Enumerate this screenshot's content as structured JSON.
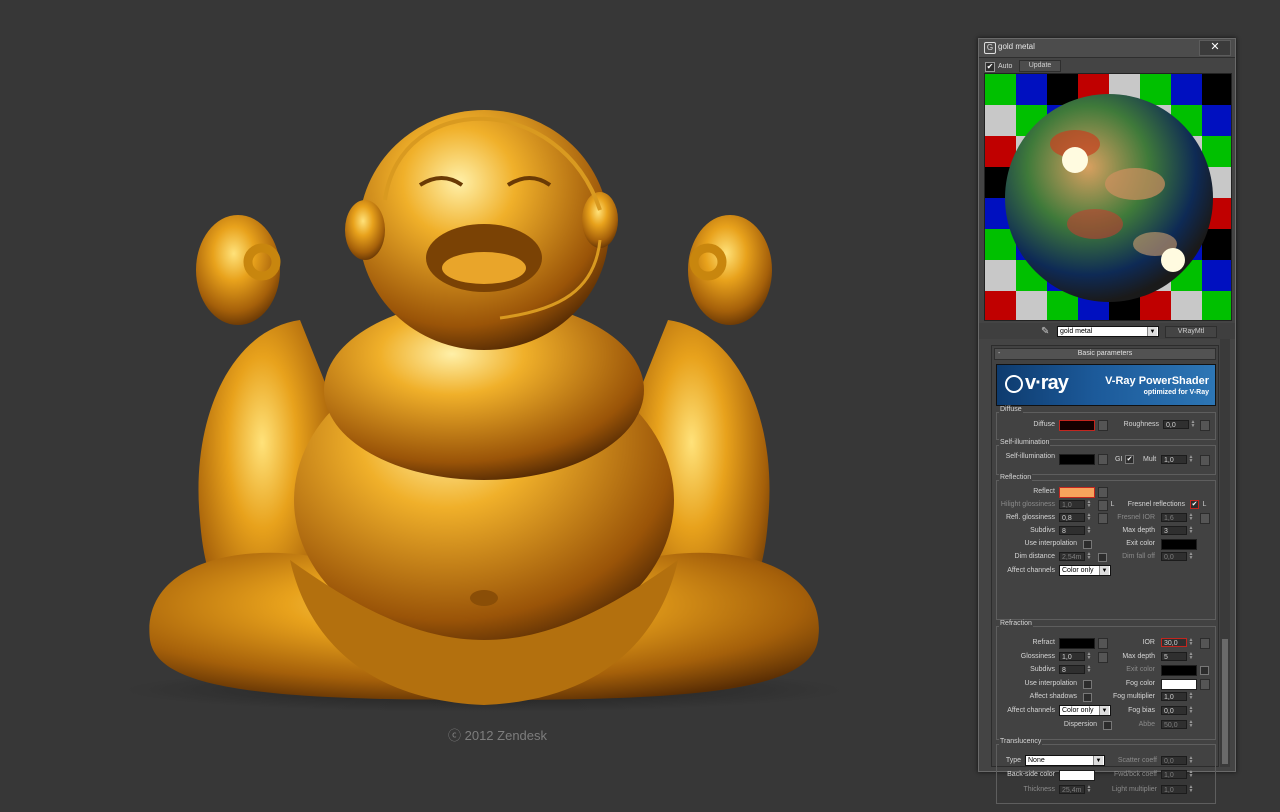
{
  "artwork": {
    "copyright": "ⓒ 2012 Zendesk"
  },
  "material_editor": {
    "window_title": "gold metal",
    "close_icon": "close-icon",
    "toolbar": {
      "auto_label": "Auto",
      "auto_checked": true,
      "update_label": "Update"
    },
    "material_name": "gold metal",
    "material_type": "VRayMtl",
    "rollout_title": "Basic parameters",
    "banner": {
      "logo": "v·ray",
      "title": "V-Ray PowerShader",
      "subtitle": "optimized for V-Ray"
    },
    "diffuse": {
      "group_title": "Diffuse",
      "diffuse_label": "Diffuse",
      "diffuse_color": "#140000",
      "roughness_label": "Roughness",
      "roughness_value": "0,0"
    },
    "self_illumination": {
      "group_title": "Self-illumination",
      "label": "Self-illumination",
      "color": "#000000",
      "gi_label": "GI",
      "gi_checked": true,
      "mult_label": "Mult",
      "mult_value": "1,0"
    },
    "reflection": {
      "group_title": "Reflection",
      "reflect_label": "Reflect",
      "reflect_color": "#f7a35c",
      "hilight_glossiness_label": "Hilight glossiness",
      "hilight_glossiness_value": "1,0",
      "l_label": "L",
      "fresnel_label": "Fresnel reflections",
      "fresnel_checked": true,
      "refl_glossiness_label": "Refl. glossiness",
      "refl_glossiness_value": "0,8",
      "fresnel_ior_label": "Fresnel IOR",
      "fresnel_ior_value": "1,6",
      "subdivs_label": "Subdivs",
      "subdivs_value": "8",
      "max_depth_label": "Max depth",
      "max_depth_value": "3",
      "use_interpolation_label": "Use interpolation",
      "exit_color_label": "Exit color",
      "exit_color": "#000000",
      "dim_distance_label": "Dim distance",
      "dim_distance_value": "2,54m",
      "dim_falloff_label": "Dim fall off",
      "dim_falloff_value": "0,0",
      "affect_channels_label": "Affect channels",
      "affect_channels_value": "Color only"
    },
    "refraction": {
      "group_title": "Refraction",
      "refract_label": "Refract",
      "refract_color": "#000000",
      "ior_label": "IOR",
      "ior_value": "30,0",
      "glossiness_label": "Glossiness",
      "glossiness_value": "1,0",
      "max_depth_label": "Max depth",
      "max_depth_value": "5",
      "subdivs_label": "Subdivs",
      "subdivs_value": "8",
      "exit_color_label": "Exit color",
      "exit_color": "#000000",
      "use_interpolation_label": "Use interpolation",
      "fog_color_label": "Fog color",
      "fog_color": "#ffffff",
      "affect_shadows_label": "Affect shadows",
      "fog_multiplier_label": "Fog multiplier",
      "fog_multiplier_value": "1,0",
      "affect_channels_label": "Affect channels",
      "affect_channels_value": "Color only",
      "fog_bias_label": "Fog bias",
      "fog_bias_value": "0,0",
      "dispersion_label": "Dispersion",
      "abbe_label": "Abbe",
      "abbe_value": "50,0"
    },
    "translucency": {
      "group_title": "Translucency",
      "type_label": "Type",
      "type_value": "None",
      "scatter_coeff_label": "Scatter coeff",
      "scatter_coeff_value": "0,0",
      "backside_color_label": "Back-side color",
      "backside_color": "#ffffff",
      "fwd_bck_coeff_label": "Fwd/bck coeff",
      "fwd_bck_coeff_value": "1,0",
      "thickness_label": "Thickness",
      "thickness_value": "25,4m",
      "light_multiplier_label": "Light multiplier",
      "light_multiplier_value": "1,0"
    }
  }
}
